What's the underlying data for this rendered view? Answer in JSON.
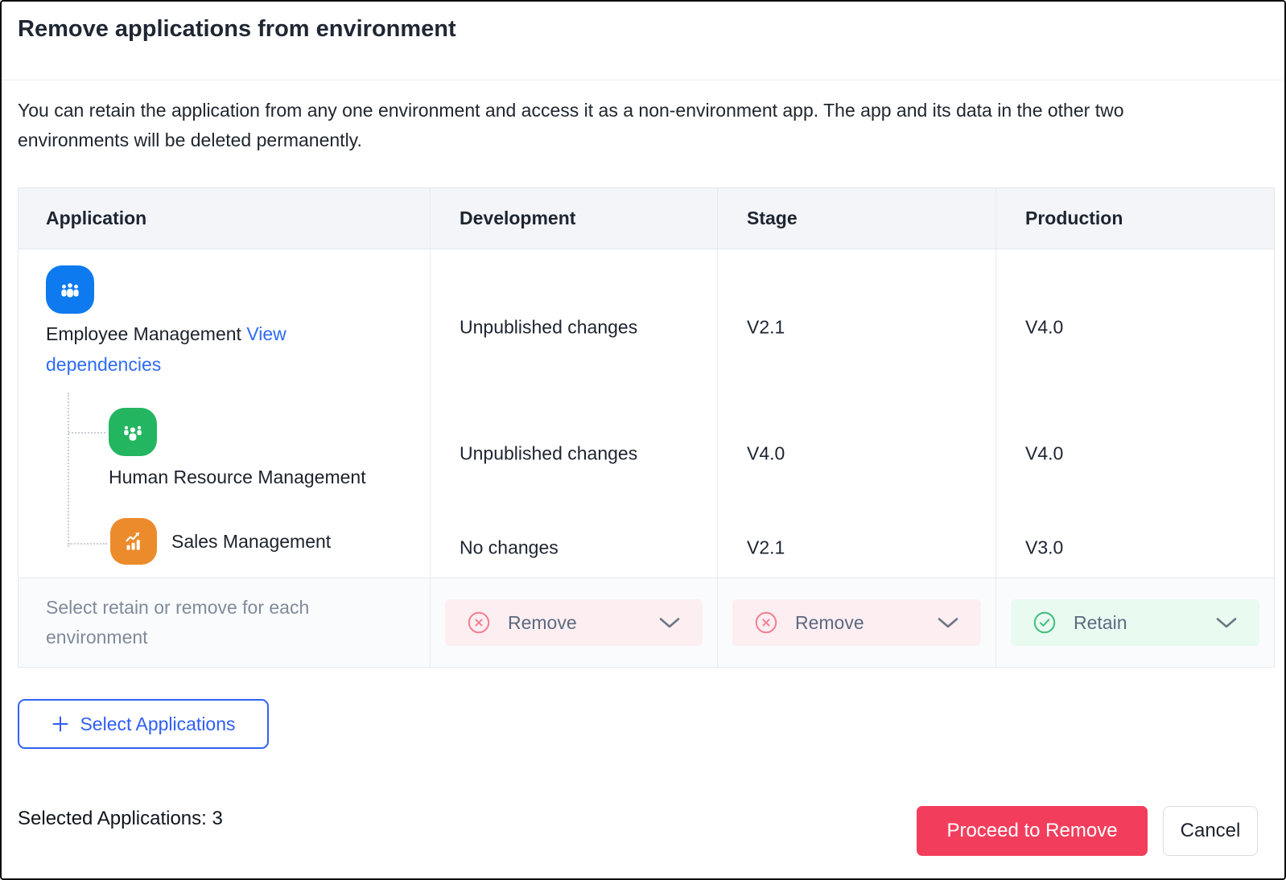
{
  "dialog": {
    "title": "Remove applications from environment",
    "description": "You can retain the application from any one environment and access it as a non-environment app. The app and its data in the other two environments will be deleted permanently."
  },
  "table": {
    "columns": [
      "Application",
      "Development",
      "Stage",
      "Production"
    ],
    "rows": [
      {
        "name": "Employee Management",
        "link": "View dependencies",
        "icon": "people-group-icon",
        "icon_color": "#0d7af0",
        "development": "Unpublished changes",
        "stage": "V2.1",
        "production": "V4.0"
      },
      {
        "name": "Human Resource Management",
        "icon": "team-icon",
        "icon_color": "#23b560",
        "development": "Unpublished changes",
        "stage": "V4.0",
        "production": "V4.0"
      },
      {
        "name": "Sales Management",
        "icon": "sales-chart-icon",
        "icon_color": "#ec8b2b",
        "development": "No changes",
        "stage": "V2.1",
        "production": "V3.0"
      }
    ],
    "selection_row": {
      "label": "Select retain or remove for each environment",
      "dropdowns": [
        {
          "env": "Development",
          "value": "Remove",
          "state": "remove"
        },
        {
          "env": "Stage",
          "value": "Remove",
          "state": "remove"
        },
        {
          "env": "Production",
          "value": "Retain",
          "state": "retain"
        }
      ]
    }
  },
  "actions": {
    "select_applications": "Select Applications",
    "selected_count_label": "Selected Applications: 3",
    "proceed": "Proceed to Remove",
    "cancel": "Cancel"
  },
  "colors": {
    "accent_blue": "#2e5ef6",
    "link_blue": "#2f6bf6",
    "danger_pink": "#f23e5c",
    "remove_bg": "#fdeef1",
    "remove_icon": "#f27f92",
    "retain_bg": "#e9faf1",
    "retain_icon": "#41bd7b",
    "header_bg": "#f4f5f9",
    "table_border": "#e4e7eb"
  }
}
